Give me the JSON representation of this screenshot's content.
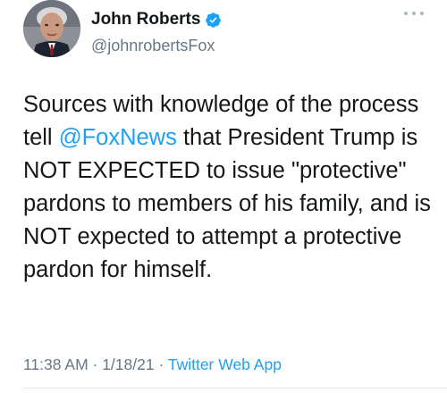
{
  "author": {
    "display_name": "John Roberts",
    "handle": "@johnrobertsFox",
    "verified": true
  },
  "tweet": {
    "text_before": "Sources with knowledge of the process tell ",
    "mention": "@FoxNews",
    "text_after": " that President Trump is NOT EXPECTED to issue \"protective\" pardons to members of his family, and is NOT expected to attempt a protective pardon for himself."
  },
  "meta": {
    "time": "11:38 AM",
    "separator1": " · ",
    "date": "1/18/21",
    "separator2": " · ",
    "source": "Twitter Web App"
  },
  "icons": {
    "verified": "verified-badge-icon",
    "more": "more-options-icon"
  },
  "colors": {
    "accent": "#1da1f2",
    "text": "#14171a",
    "secondary": "#657786"
  }
}
